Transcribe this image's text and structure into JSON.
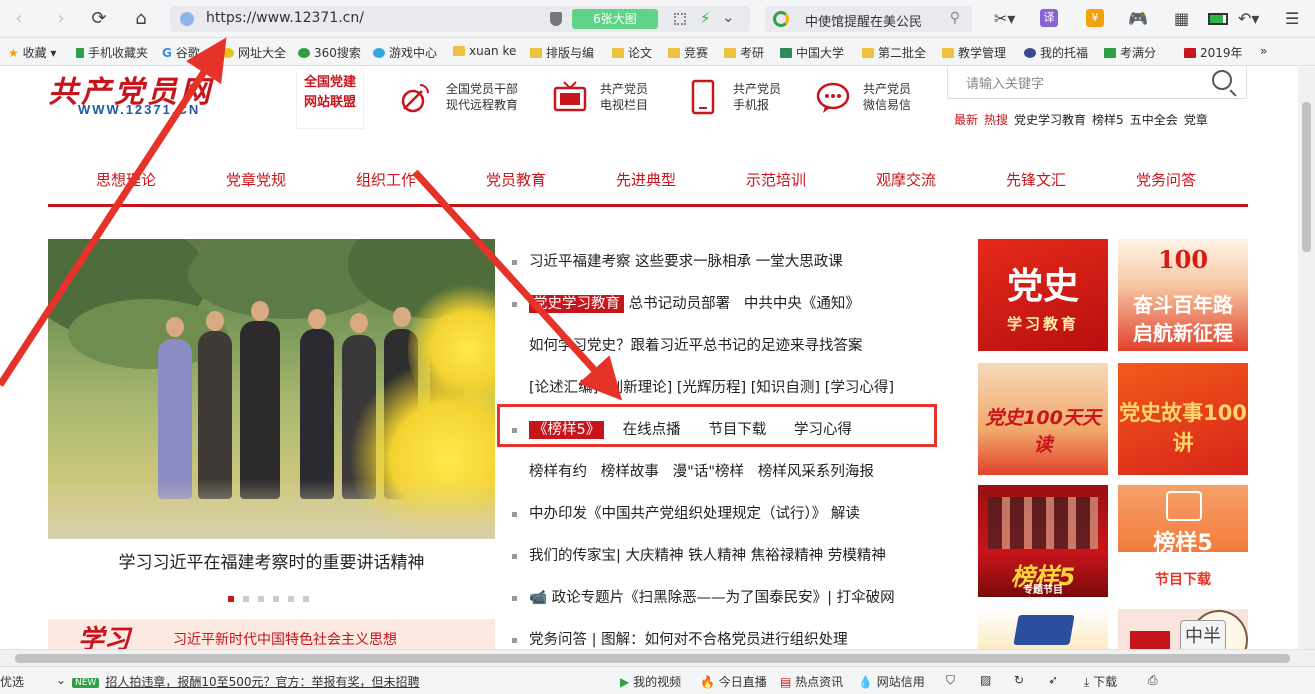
{
  "browser": {
    "url": "https://www.12371.cn/",
    "big_image_label": "6张大图",
    "search_text": "中使馆提醒在美公民",
    "translate_label": "译",
    "bookmarks": [
      "收藏",
      "手机收藏夹",
      "谷歌",
      "网址大全",
      "360搜索",
      "游戏中心",
      "xuan ke",
      "排版与编",
      "论文",
      "竞赛",
      "考研",
      "中国大学",
      "第二批全",
      "教学管理",
      "我的托福",
      "考满分",
      "2019年"
    ],
    "more": "»"
  },
  "site": {
    "logo_text": "共产党员网",
    "logo_url": "WWW.12371.CN",
    "alliance": [
      "全国党建",
      "网站联盟"
    ],
    "services": [
      {
        "line1": "全国党员干部",
        "line2": "现代远程教育"
      },
      {
        "line1": "共产党员",
        "line2": "电视栏目"
      },
      {
        "line1": "共产党员",
        "line2": "手机报"
      },
      {
        "line1": "共产党员",
        "line2": "微信易信"
      }
    ],
    "search_placeholder": "请输入关键字",
    "hot": {
      "latest": "最新",
      "hot": "热搜",
      "items": [
        "党史学习教育",
        "榜样5",
        "五中全会",
        "党章"
      ]
    }
  },
  "nav": [
    "思想理论",
    "党章党规",
    "组织工作",
    "党员教育",
    "先进典型",
    "示范培训",
    "观摩交流",
    "先锋文汇",
    "党务问答"
  ],
  "slide": {
    "caption": "学习习近平在福建考察时的重要讲话精神",
    "dots": 6,
    "active": 1
  },
  "banner": {
    "logo": "学习",
    "text": "习近平新时代中国特色社会主义思想"
  },
  "news": [
    {
      "parts": [
        {
          "t": "习近平福建考察 这些要求一脉相承 一堂大思政课"
        }
      ]
    },
    {
      "parts": [
        {
          "t": "党史学习教育",
          "tag": true
        },
        {
          "t": " 总书记动员部署"
        },
        {
          "t": "   中共中央《通知》"
        }
      ]
    },
    {
      "parts": [
        {
          "t": "如何学习党史？跟着习近平总书记的足迹来寻找答案"
        }
      ],
      "nobullet": true
    },
    {
      "parts": [
        {
          "t": "[论述汇编] [创新理论] [光辉历程] [知识自测] [学习心得]"
        }
      ],
      "nobullet": true
    },
    {
      "parts": [
        {
          "t": "《榜样5》",
          "tag": true
        },
        {
          "t": "    在线点播"
        },
        {
          "t": "      节目下载"
        },
        {
          "t": "      学习心得"
        }
      ]
    },
    {
      "parts": [
        {
          "t": "榜样有约   榜样故事   漫\"话\"榜样   榜样风采系列海报"
        }
      ],
      "nobullet": true
    },
    {
      "parts": [
        {
          "t": "中办印发《中国共产党组织处理规定（试行）》 解读"
        }
      ]
    },
    {
      "parts": [
        {
          "t": "我们的传家宝| 大庆精神 铁人精神 焦裕禄精神 劳模精神"
        }
      ]
    },
    {
      "parts": [
        {
          "t": "📹 政论专题片《扫黑除恶——为了国泰民安》| 打伞破网"
        }
      ]
    },
    {
      "parts": [
        {
          "t": "党务问答 | 图解：如何对不合格党员进行组织处理"
        }
      ]
    }
  ],
  "tiles": [
    {
      "big": "党史",
      "small": "学习教育"
    },
    {
      "big": "奋斗百年路",
      "small": "启航新征程",
      "top": "100"
    },
    {
      "big": "党史100天天读",
      "small": ""
    },
    {
      "big": "党史故事100讲",
      "small": ""
    },
    {
      "big": "榜样5",
      "small": "专题节目"
    },
    {
      "big": "榜样5",
      "small": "节目下载"
    }
  ],
  "widget_text": "中半",
  "statusbar": {
    "left": "优选",
    "new_badge": "NEW",
    "headline": "招人拍违章，报酬10至500元？官方：举报有奖，但未招聘",
    "items": [
      "我的视频",
      "今日直播",
      "热点资讯",
      "网站信用"
    ],
    "download": "下载"
  },
  "colors": {
    "party_red": "#c8141b",
    "annotation_red": "#e5332a"
  }
}
